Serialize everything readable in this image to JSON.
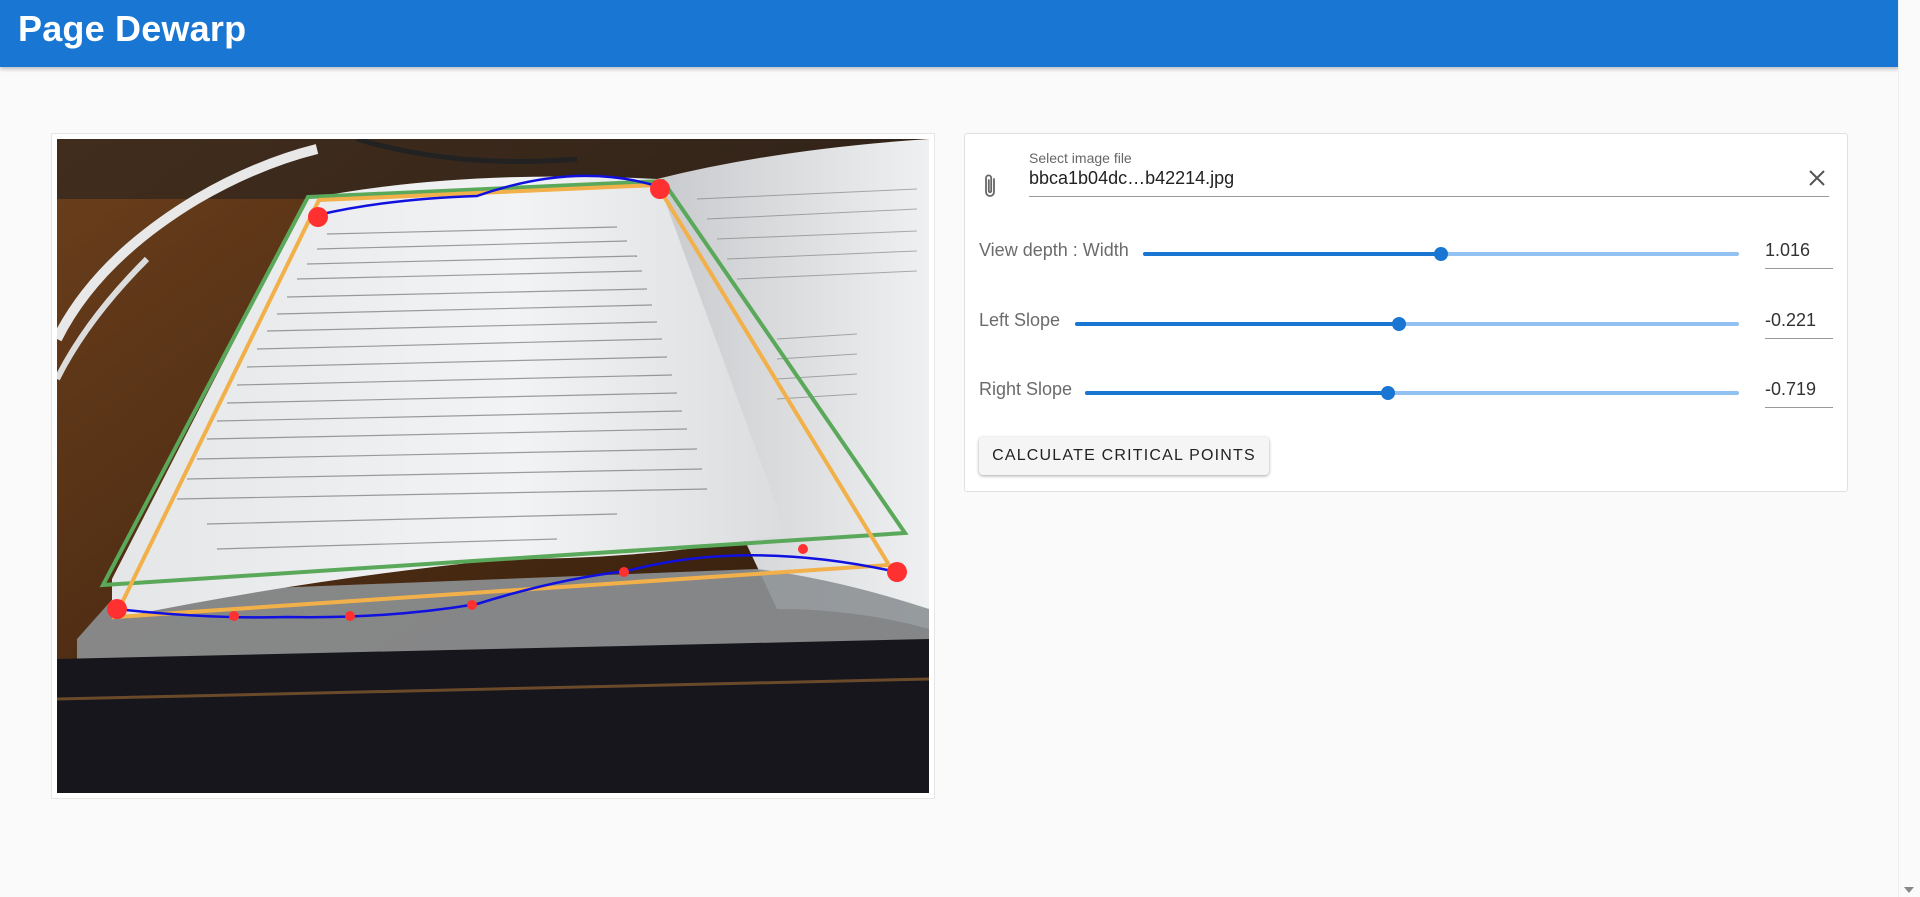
{
  "app": {
    "title": "Page Dewarp"
  },
  "file_input": {
    "label": "Select image file",
    "value": "bbca1b04dc…b42214.jpg",
    "clip_icon": "paperclip-icon",
    "clear_icon": "close-icon"
  },
  "sliders": [
    {
      "label": "View depth : Width",
      "value": "1.016",
      "position": 0.5
    },
    {
      "label": "Left Slope",
      "value": "-0.221",
      "position": 0.488
    },
    {
      "label": "Right Slope",
      "value": "-0.719",
      "position": 0.463
    }
  ],
  "calc_button": {
    "label": "CALCULATE CRITICAL POINTS"
  },
  "colors": {
    "appbar": "#1976d2",
    "accent": "#1976d2",
    "outer_quad": "#5aa85a",
    "inner_quad": "#f2b04a",
    "curve": "#1010e0",
    "points": "#ff3030"
  }
}
